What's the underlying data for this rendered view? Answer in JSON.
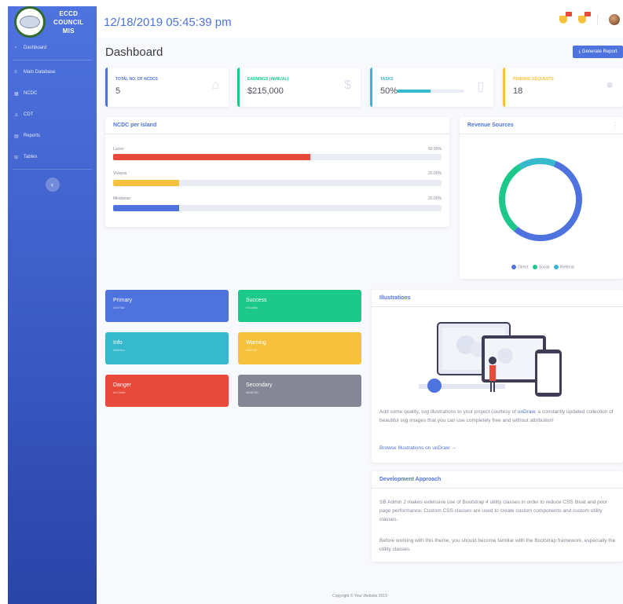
{
  "brand": {
    "line1": "ECCD",
    "line2": "COUNCIL",
    "line3": "MIS"
  },
  "sidebar": {
    "items": [
      {
        "label": "Dashboard",
        "icon": "dashboard-icon"
      },
      {
        "label": "Main Database",
        "icon": "database-icon"
      },
      {
        "label": "NCDC",
        "icon": "building-icon"
      },
      {
        "label": "CDT",
        "icon": "user-icon"
      },
      {
        "label": "Reports",
        "icon": "report-icon"
      },
      {
        "label": "Tables",
        "icon": "table-icon"
      }
    ],
    "toggle": "‹"
  },
  "topbar": {
    "datetime": "12/18/2019 05:45:39 pm"
  },
  "page": {
    "title": "Dashboard",
    "report_button": "⤓ Generate Report"
  },
  "stats": [
    {
      "label": "TOTAL NO. OF NCDCs",
      "value": "5",
      "icon": "home-icon"
    },
    {
      "label": "EARNINGS (ANNUAL)",
      "value": "$215,000",
      "icon": "dollar-icon"
    },
    {
      "label": "TASKS",
      "value": "50%",
      "progress": 0.5,
      "icon": "clipboard-icon"
    },
    {
      "label": "PENDING REQUESTS",
      "value": "18",
      "icon": "comments-icon"
    }
  ],
  "ncdc_card": {
    "title": "NCDC per Island",
    "rows": [
      {
        "label": "Luzon",
        "pct": "60.00%",
        "value": 0.6,
        "color": "#e74a3b"
      },
      {
        "label": "Visayas",
        "pct": "20.00%",
        "value": 0.2,
        "color": "#f6c23e"
      },
      {
        "label": "Mindanao",
        "pct": "20.00%",
        "value": 0.2,
        "color": "#4e73df"
      }
    ]
  },
  "revenue_card": {
    "title": "Revenue Sources",
    "legend": [
      {
        "label": "Direct",
        "color": "#4e73df"
      },
      {
        "label": "Social",
        "color": "#1cc88a"
      },
      {
        "label": "Referral",
        "color": "#36b9cc"
      }
    ],
    "donut_shares": [
      0.55,
      0.3,
      0.15
    ]
  },
  "color_cards": [
    {
      "title": "Primary",
      "sub": "#4e73df",
      "color": "#4e73df"
    },
    {
      "title": "Success",
      "sub": "#1cc88a",
      "color": "#1cc88a"
    },
    {
      "title": "Info",
      "sub": "#36b9cc",
      "color": "#36b9cc"
    },
    {
      "title": "Warning",
      "sub": "#f6c23e",
      "color": "#f6c23e"
    },
    {
      "title": "Danger",
      "sub": "#e74a3b",
      "color": "#e74a3b"
    },
    {
      "title": "Secondary",
      "sub": "#858796",
      "color": "#858796"
    }
  ],
  "illustrations": {
    "title": "Illustrations",
    "text_before": "Add some quality, svg illustrations to your project courtesy of ",
    "brand_link": "unDraw",
    "text_after": ", a constantly updated collection of beautiful svg images that you can use completely free and without attribution!",
    "link": "Browse Illustrations on unDraw →"
  },
  "development": {
    "title": "Development Approach",
    "p1": "SB Admin 2 makes extensive use of Bootstrap 4 utility classes in order to reduce CSS bloat and poor page performance. Custom CSS classes are used to create custom components and custom utility classes.",
    "p2": "Before working with this theme, you should become familiar with the Bootstrap framework, especially the utility classes."
  },
  "footer": {
    "copyright": "Copyright © Your Website 2019"
  }
}
